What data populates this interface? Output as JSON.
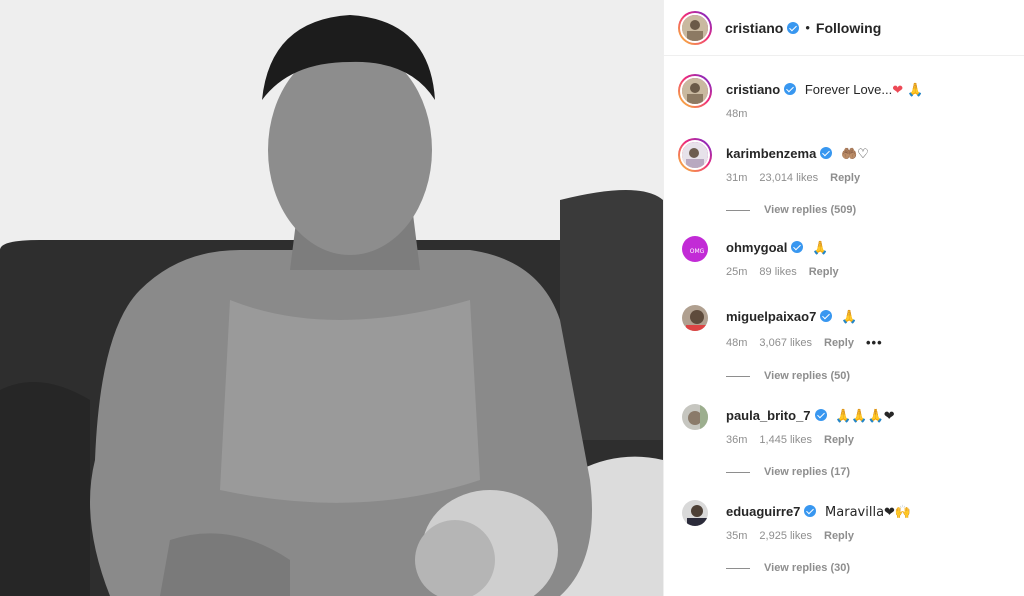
{
  "post": {
    "author": "cristiano",
    "follow_status": "Following",
    "dot": "•"
  },
  "caption": {
    "user": "cristiano",
    "text": "Forever Love...",
    "emojis": "❤ 🙏",
    "time": "48m"
  },
  "comments": [
    {
      "user": "karimbenzema",
      "text": "🤲🏽♡",
      "time": "31m",
      "likes": "23,014 likes",
      "reply": "Reply",
      "view_replies": "View replies (509)"
    },
    {
      "user": "ohmygoal",
      "text": "🙏",
      "time": "25m",
      "likes": "89 likes",
      "reply": "Reply"
    },
    {
      "user": "miguelpaixao7",
      "text": "🙏",
      "time": "48m",
      "likes": "3,067 likes",
      "reply": "Reply",
      "more": "•••",
      "view_replies": "View replies (50)"
    },
    {
      "user": "paula_brito_7",
      "text": "🙏🙏🙏❤",
      "time": "36m",
      "likes": "1,445 likes",
      "reply": "Reply",
      "view_replies": "View replies (17)"
    },
    {
      "user": "eduaguirre7",
      "text": "Maravilla❤🙌",
      "time": "35m",
      "likes": "2,925 likes",
      "reply": "Reply",
      "view_replies": "View replies (30)"
    }
  ],
  "icons": {
    "verified": "verified-badge-icon",
    "more": "more-options-icon"
  },
  "colors": {
    "verified": "#3897f0",
    "story_ring": "#ee2a7b",
    "muted_text": "#8e8e8e"
  }
}
